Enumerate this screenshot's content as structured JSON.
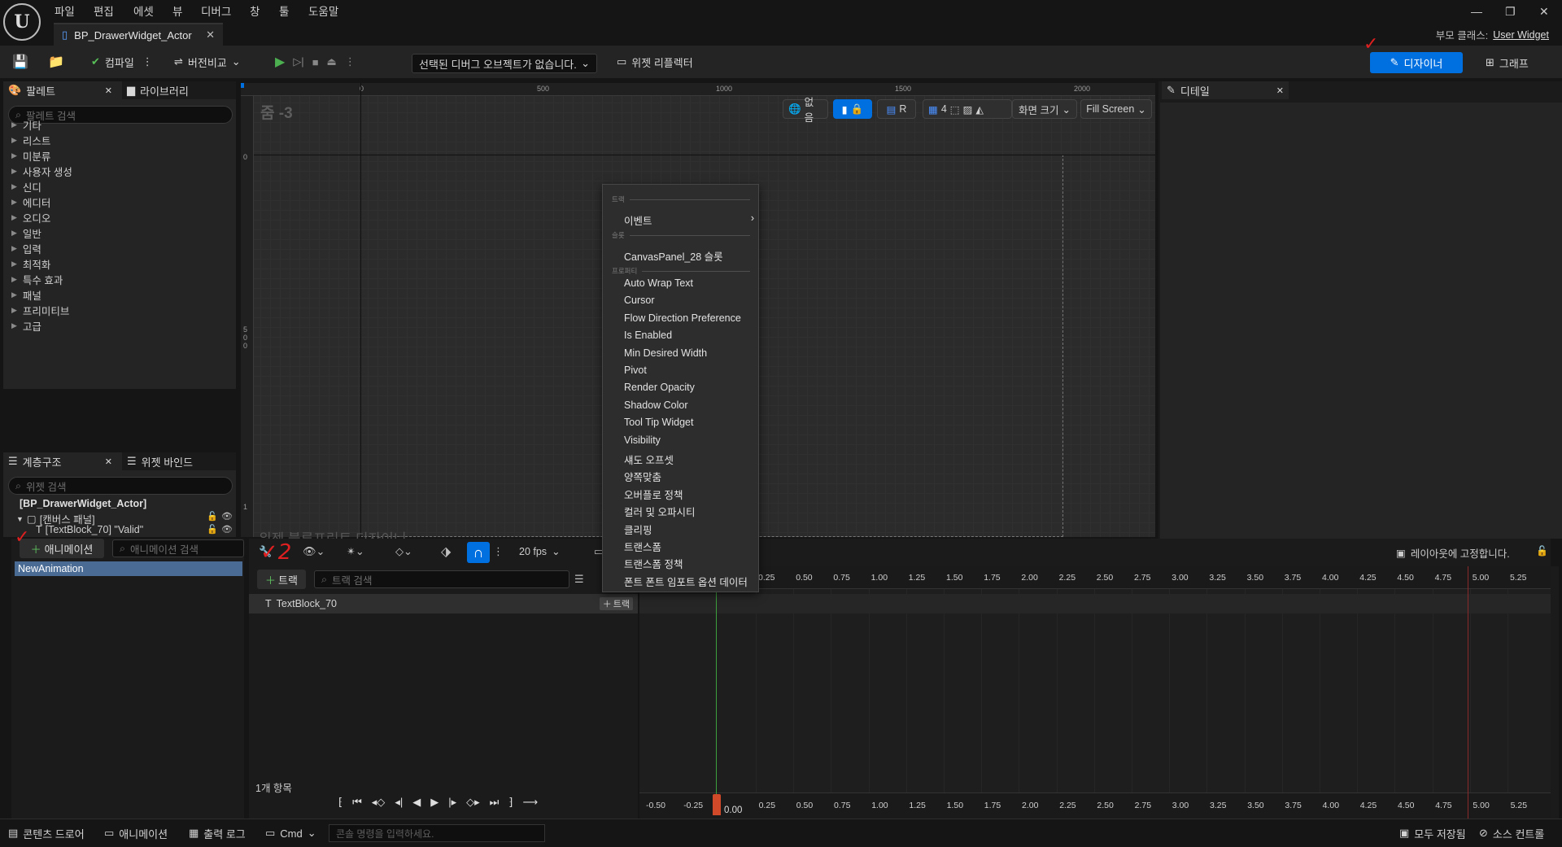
{
  "menu": [
    "파일",
    "편집",
    "에셋",
    "뷰",
    "디버그",
    "창",
    "툴",
    "도움말"
  ],
  "document_tab": {
    "title": "BP_DrawerWidget_Actor"
  },
  "parent_class": {
    "label": "부모 클래스:",
    "value": "User Widget"
  },
  "toolbar": {
    "compile_label": "컴파일",
    "diff_label": "버전비교",
    "debug_object": "선택된 디버그 오브젝트가 없습니다.",
    "widget_reflector": "위젯 리플렉터",
    "designer_label": "디자이너",
    "graph_label": "그래프"
  },
  "palette": {
    "tab_label": "팔레트",
    "library_tab": "라이브러리",
    "search_placeholder": "팔레트 검색",
    "categories": [
      "기타",
      "리스트",
      "미분류",
      "사용자 생성",
      "신디",
      "에디터",
      "오디오",
      "일반",
      "입력",
      "최적화",
      "특수 효과",
      "패널",
      "프리미티브",
      "고급"
    ]
  },
  "hierarchy": {
    "tab_label": "계층구조",
    "bindings_tab": "위젯 바인드",
    "search_placeholder": "위젯 검색",
    "root": "[BP_DrawerWidget_Actor]",
    "canvas": "[캔버스 패널]",
    "textblock": "[TextBlock_70] \"Valid\""
  },
  "viewport": {
    "zoom": "줌 -3",
    "ruler_top": [
      "0",
      "500",
      "1000",
      "1500",
      "2000"
    ],
    "ruler_left": [
      "0",
      "500",
      "1"
    ],
    "none_label": "없음",
    "r_label": "R",
    "grid_value": "4",
    "screen_size": "화면 크기",
    "fill_screen": "Fill Screen",
    "overlay_text": "위젯 블루프린트 디자이너"
  },
  "details": {
    "tab_label": "디테일"
  },
  "context_menu": {
    "section_track": "트랙",
    "event_item": "이벤트",
    "section_slot": "슬롯",
    "slot_item": "CanvasPanel_28 슬롯",
    "section_property": "프로퍼티",
    "properties": [
      "Auto Wrap Text",
      "Cursor",
      "Flow Direction Preference",
      "Is Enabled",
      "Min Desired Width",
      "Pivot",
      "Render Opacity",
      "Shadow Color",
      "Tool Tip Widget",
      "Visibility",
      "섀도 오프셋",
      "양쪽맞춤",
      "오버플로 정책",
      "컬러 및 오파시티",
      "클리핑",
      "트랜스폼",
      "트랜스폼 정책",
      "폰트 폰트 임포트 옵션 데이터"
    ]
  },
  "animation": {
    "add_button": "애니메이션",
    "search_placeholder": "애니메이션 검색",
    "items": [
      "NewAnimation"
    ],
    "track_button": "트랙",
    "track_search": "트랙 검색",
    "track_row": "TextBlock_70",
    "row_track_button": "트랙",
    "fps": "20 fps",
    "item_count": "1개 항목",
    "lock_layout": "레이아웃에 고정합니다.",
    "current_time": "0.00",
    "time_ticks": [
      "0.25",
      "0.50",
      "0.75",
      "1.00",
      "1.25",
      "1.50",
      "1.75",
      "2.00",
      "2.25",
      "2.50",
      "2.75",
      "3.00",
      "3.25",
      "3.50",
      "3.75",
      "4.00",
      "4.25",
      "4.50",
      "4.75",
      "5.00",
      "5.25"
    ],
    "bottom_ticks": [
      "-0.50",
      "-0.25",
      "0.25",
      "0.50",
      "0.75",
      "1.00",
      "1.25",
      "1.50",
      "1.75",
      "2.00",
      "2.25",
      "2.50",
      "2.75",
      "3.00",
      "3.25",
      "3.50",
      "3.75",
      "4.00",
      "4.25",
      "4.50",
      "4.75",
      "5.00",
      "5.25"
    ]
  },
  "statusbar": {
    "content_drawer": "콘텐츠 드로어",
    "animation": "애니메이션",
    "output_log": "출력 로그",
    "cmd": "Cmd",
    "console_placeholder": "콘솔 명령을 입력하세요.",
    "all_saved": "모두 저장됨",
    "source_control": "소스 컨트롤"
  },
  "annotations": {
    "mark1": "✓",
    "mark2": "✓2",
    "mark3": "✓"
  },
  "colors": {
    "accent": "#0070e0",
    "play_green": "#4caf50",
    "playhead": "#d04a2a"
  }
}
